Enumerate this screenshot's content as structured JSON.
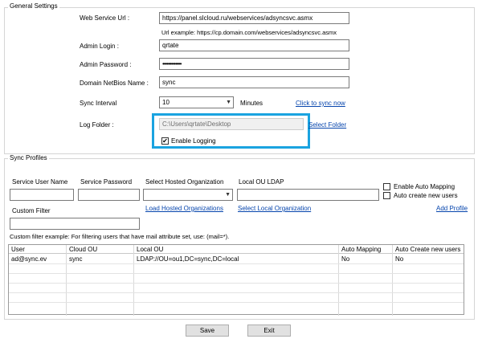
{
  "general": {
    "title": "General Settings",
    "web_service_url_label": "Web Service Url :",
    "web_service_url_value": "https://panel.slcloud.ru/webservices/adsyncsvc.asmx",
    "url_example": "Url example: https://cp.domain.com/webservices/adsyncsvc.asmx",
    "admin_login_label": "Admin Login :",
    "admin_login_value": "qrtate",
    "admin_password_label": "Admin Password :",
    "admin_password_value": "•••••••••••••",
    "netbios_label": "Domain NetBios Name :",
    "netbios_value": "sync",
    "sync_interval_label": "Sync Interval",
    "sync_interval_value": "10",
    "minutes_label": "Minutes",
    "click_to_sync": "Click to sync now",
    "log_folder_label": "Log Folder :",
    "log_folder_value": "C:\\Users\\qrtate\\Desktop",
    "select_folder": "Select Folder",
    "enable_logging_label": "Enable Logging",
    "enable_logging_checked": true
  },
  "profiles": {
    "title": "Sync Profiles",
    "service_user_label": "Service User Name",
    "service_user_value": "",
    "service_password_label": "Service Password",
    "service_password_value": "",
    "hosted_org_label": "Select Hosted Organization",
    "hosted_org_value": "",
    "local_ou_label": "Local OU LDAP",
    "local_ou_value": "",
    "enable_auto_mapping": "Enable Auto Mapping",
    "auto_create_users": "Auto create new users",
    "custom_filter_label": "Custom Filter",
    "custom_filter_value": "",
    "load_hosted_orgs": "Load Hosted Organizations",
    "select_local_org": "Select Local Organization",
    "add_profile": "Add Profile",
    "filter_example": "Custom filter example: For filtering users that have mail attribute set, use: (mail=*).",
    "columns": [
      "User",
      "Cloud OU",
      "Local OU",
      "Auto Mapping",
      "Auto Create new users"
    ],
    "rows": [
      [
        "ad@sync.ev",
        "sync",
        "LDAP://OU=ou1,DC=sync,DC=local",
        "No",
        "No"
      ]
    ]
  },
  "buttons": {
    "save": "Save",
    "exit": "Exit"
  },
  "colors": {
    "highlight": "#1aa3e0",
    "link": "#0645ad"
  }
}
